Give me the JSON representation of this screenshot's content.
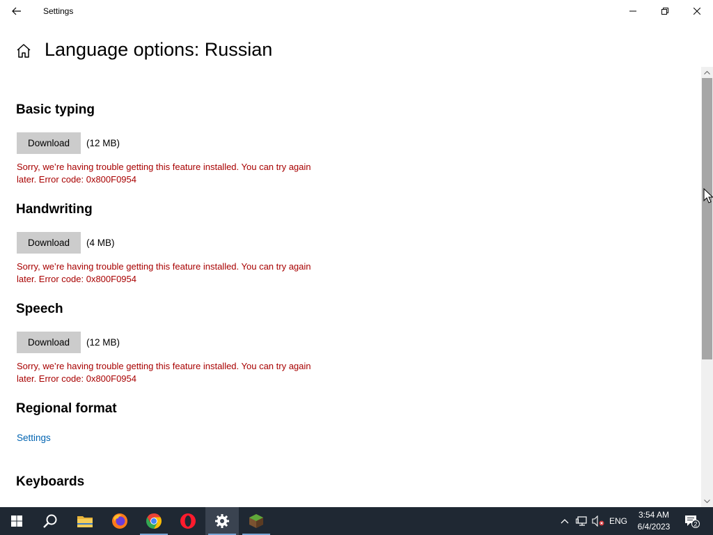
{
  "window": {
    "title": "Settings",
    "back_icon": "back-arrow-icon",
    "controls": [
      "minimize-icon",
      "restore-icon",
      "close-icon"
    ]
  },
  "page": {
    "title": "Language options: Russian",
    "home_icon": "home-icon"
  },
  "sections": {
    "basic_typing": {
      "heading": "Basic typing",
      "button": "Download",
      "size": "(12 MB)",
      "error": "Sorry, we’re having trouble getting this feature installed. You can try again later. Error code: 0x800F0954"
    },
    "handwriting": {
      "heading": "Handwriting",
      "button": "Download",
      "size": "(4 MB)",
      "error": "Sorry, we’re having trouble getting this feature installed. You can try again later. Error code: 0x800F0954"
    },
    "speech": {
      "heading": "Speech",
      "button": "Download",
      "size": "(12 MB)",
      "error": "Sorry, we’re having trouble getting this feature installed. You can try again later. Error code: 0x800F0954"
    },
    "regional_format": {
      "heading": "Regional format",
      "link": "Settings"
    },
    "keyboards": {
      "heading": "Keyboards"
    }
  },
  "taskbar": {
    "apps": [
      "start-icon",
      "search-icon",
      "file-explorer-icon",
      "firefox-icon",
      "chrome-icon",
      "opera-icon",
      "settings-icon",
      "minecraft-icon"
    ],
    "active_app": "settings-icon",
    "tray": {
      "language": "ENG",
      "time": "3:54 AM",
      "date": "6/4/2023",
      "notification_count": "2"
    }
  },
  "colors": {
    "error": "#a80000",
    "link": "#0063b1",
    "button": "#cccccc",
    "taskbar": "#1f2833"
  }
}
